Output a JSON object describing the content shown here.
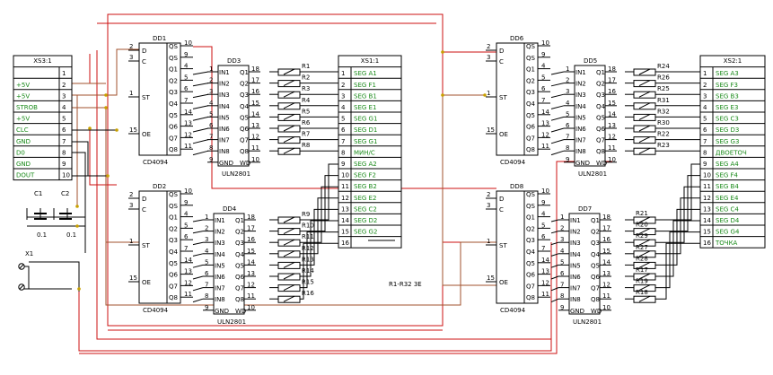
{
  "xs3": {
    "title": "XS3:1",
    "rows": [
      {
        "label": "",
        "num": "1"
      },
      {
        "label": "+5V",
        "num": "2"
      },
      {
        "label": "+5V",
        "num": "3"
      },
      {
        "label": "STROB",
        "num": "4"
      },
      {
        "label": "+5V",
        "num": "5"
      },
      {
        "label": "CLC",
        "num": "6"
      },
      {
        "label": "GND",
        "num": "7"
      },
      {
        "label": "D0",
        "num": "8"
      },
      {
        "label": "GND",
        "num": "9"
      },
      {
        "label": "DOUT",
        "num": "10"
      }
    ]
  },
  "caps": [
    {
      "name": "C1",
      "value": "0.1"
    },
    {
      "name": "C2",
      "value": "0.1"
    }
  ],
  "x1": "X1",
  "note": "R1-R32  3E",
  "cd4094": {
    "part": "CD4094",
    "left_pins": [
      {
        "num": "2",
        "name": "D"
      },
      {
        "num": "3",
        "name": "C"
      },
      {
        "num": "1",
        "name": "ST"
      },
      {
        "num": "15",
        "name": "OE"
      }
    ],
    "right_pins": [
      {
        "name": "QS",
        "num": "10"
      },
      {
        "name": "QS",
        "num": "9"
      },
      {
        "name": "Q1",
        "num": "4"
      },
      {
        "name": "Q2",
        "num": "5"
      },
      {
        "name": "Q3",
        "num": "6"
      },
      {
        "name": "Q4",
        "num": "7"
      },
      {
        "name": "Q5",
        "num": "14"
      },
      {
        "name": "Q6",
        "num": "13"
      },
      {
        "name": "Q7",
        "num": "12"
      },
      {
        "name": "Q8",
        "num": "11"
      }
    ]
  },
  "uln": {
    "part": "ULN2801",
    "in_pins": [
      {
        "num": "1",
        "name": "IN1"
      },
      {
        "num": "2",
        "name": "IN2"
      },
      {
        "num": "3",
        "name": "IN3"
      },
      {
        "num": "4",
        "name": "IN4"
      },
      {
        "num": "5",
        "name": "IN5"
      },
      {
        "num": "6",
        "name": "IN6"
      },
      {
        "num": "7",
        "name": "IN7"
      },
      {
        "num": "8",
        "name": "IN8"
      },
      {
        "num": "9",
        "name": "GND"
      }
    ],
    "out_pins": [
      {
        "name": "Q1",
        "num": "18"
      },
      {
        "name": "Q2",
        "num": "17"
      },
      {
        "name": "Q3",
        "num": "16"
      },
      {
        "name": "Q4",
        "num": "15"
      },
      {
        "name": "Q5",
        "num": "14"
      },
      {
        "name": "Q6",
        "num": "13"
      },
      {
        "name": "Q7",
        "num": "12"
      },
      {
        "name": "Q8",
        "num": "11"
      },
      {
        "name": "WD",
        "num": "10"
      }
    ]
  },
  "shift_registers": [
    "DD1",
    "DD2",
    "DD6",
    "DD8"
  ],
  "drivers": [
    "DD3",
    "DD4",
    "DD5",
    "DD7"
  ],
  "resistors": {
    "dd3": [
      "R1",
      "R2",
      "R3",
      "R4",
      "R5",
      "R6",
      "R7",
      "R8"
    ],
    "dd4": [
      "R9",
      "R10",
      "R11",
      "R12",
      "R13",
      "R14",
      "R15",
      "R16"
    ],
    "dd5": [
      "R24",
      "R26",
      "R25",
      "R31",
      "R32",
      "R30",
      "R22",
      "R23"
    ],
    "dd7": [
      "R21",
      "R20",
      "R29",
      "R27",
      "R28",
      "R17",
      "R19",
      "R18"
    ]
  },
  "xs1": {
    "title": "XS1:1",
    "rows": [
      {
        "num": "1",
        "label": "SEG A1"
      },
      {
        "num": "2",
        "label": "SEG F1"
      },
      {
        "num": "3",
        "label": "SEG B1"
      },
      {
        "num": "4",
        "label": "SEG E1"
      },
      {
        "num": "5",
        "label": "SEG G1"
      },
      {
        "num": "6",
        "label": "SEG D1"
      },
      {
        "num": "7",
        "label": "SEG G1"
      },
      {
        "num": "8",
        "label": "МИН/С"
      },
      {
        "num": "9",
        "label": "SEG A2"
      },
      {
        "num": "10",
        "label": "SEG F2"
      },
      {
        "num": "11",
        "label": "SEG B2"
      },
      {
        "num": "12",
        "label": "SEG E2"
      },
      {
        "num": "13",
        "label": "SEG C2"
      },
      {
        "num": "14",
        "label": "SEG D2"
      },
      {
        "num": "15",
        "label": "SEG G2"
      },
      {
        "num": "16",
        "label": ""
      }
    ]
  },
  "xs2": {
    "title": "XS2:1",
    "rows": [
      {
        "num": "1",
        "label": "SEG A3"
      },
      {
        "num": "2",
        "label": "SEG F3"
      },
      {
        "num": "3",
        "label": "SEG B3"
      },
      {
        "num": "4",
        "label": "SEG E3"
      },
      {
        "num": "5",
        "label": "SEG C3"
      },
      {
        "num": "6",
        "label": "SEG D3"
      },
      {
        "num": "7",
        "label": "SEG G3"
      },
      {
        "num": "8",
        "label": "ДВОЕТОЧ"
      },
      {
        "num": "9",
        "label": "SEG A4"
      },
      {
        "num": "10",
        "label": "SEG F4"
      },
      {
        "num": "11",
        "label": "SEG B4"
      },
      {
        "num": "12",
        "label": "SEG E4"
      },
      {
        "num": "13",
        "label": "SEG C4"
      },
      {
        "num": "14",
        "label": "SEG D4"
      },
      {
        "num": "15",
        "label": "SEG G4"
      },
      {
        "num": "16",
        "label": "ТОЧКА"
      }
    ]
  }
}
